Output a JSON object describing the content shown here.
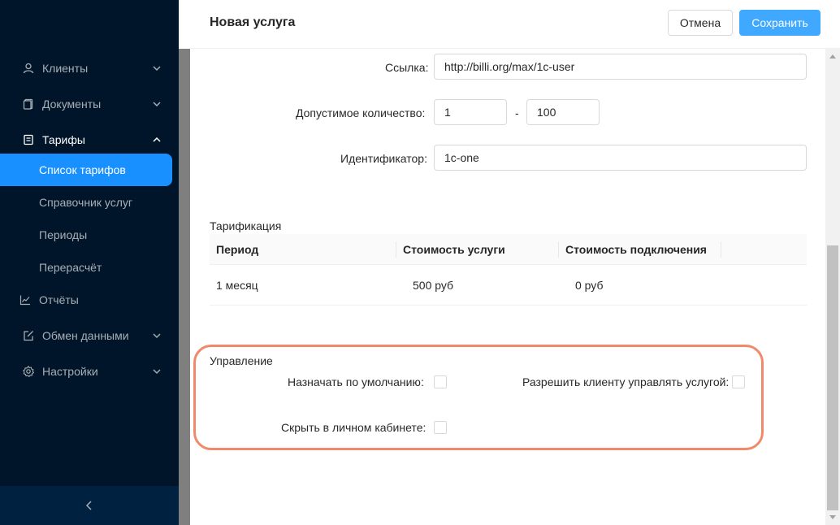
{
  "sidebar": {
    "items": [
      {
        "label": "Клиенты",
        "icon": "user-icon",
        "chevron": "chevron-down-icon"
      },
      {
        "label": "Документы",
        "icon": "document-icon",
        "chevron": "chevron-down-icon"
      },
      {
        "label": "Тарифы",
        "icon": "tariff-icon",
        "chevron": "chevron-up-icon"
      },
      {
        "label": "Отчёты",
        "icon": "line-chart-icon",
        "chevron": ""
      },
      {
        "label": "Обмен данными",
        "icon": "edit-icon",
        "chevron": "chevron-down-icon"
      },
      {
        "label": "Настройки",
        "icon": "gear-icon",
        "chevron": "chevron-down-icon"
      }
    ],
    "sub_items": [
      {
        "label": "Список тарифов",
        "active": true
      },
      {
        "label": "Справочник услуг",
        "active": false
      },
      {
        "label": "Периоды",
        "active": false
      },
      {
        "label": "Перерасчёт",
        "active": false
      }
    ],
    "collapse_icon": "chevron-left-icon"
  },
  "drawer": {
    "title": "Новая услуга",
    "cancel_label": "Отмена",
    "save_label": "Сохранить"
  },
  "form": {
    "link_label": "Ссылка",
    "link_value": "http://billi.org/max/1c-user",
    "quantity_label": "Допустимое количество",
    "quantity_min": "1",
    "quantity_separator": "-",
    "quantity_max": "100",
    "identifier_label": "Идентификатор",
    "identifier_value": "1c-one",
    "label_colon": ":"
  },
  "billing": {
    "title": "Тарификация",
    "columns": [
      "Период",
      "Стоимость услуги",
      "Стоимость подключения"
    ],
    "rows": [
      [
        "1 месяц",
        "500 руб",
        "0 руб"
      ]
    ]
  },
  "management": {
    "title": "Управление",
    "default_assign_label": "Назначать по умолчанию",
    "default_assign_checked": false,
    "client_manage_label": "Разрешить клиенту управлять услугой",
    "client_manage_checked": false,
    "hide_cabinet_label": "Скрыть в личном кабинете",
    "hide_cabinet_checked": false
  },
  "colors": {
    "sidebar_bg": "#001529",
    "accent": "#1890ff",
    "save_button": "#40a9ff",
    "highlight": "#f08a6a"
  }
}
